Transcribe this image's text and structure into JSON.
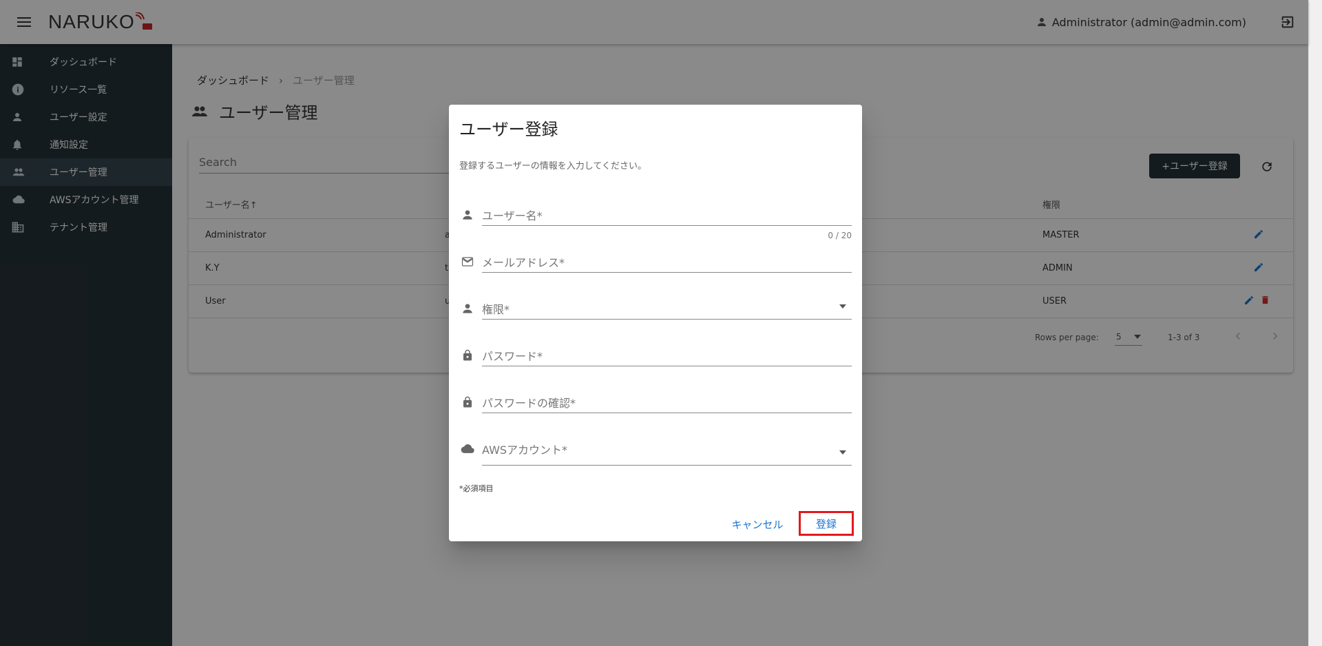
{
  "appbar": {
    "menu_icon": "menu-icon",
    "logo_text": "NARUKO",
    "user_label": "Administrator (admin@admin.com)",
    "user_icon": "person-icon",
    "logout_icon": "logout-icon"
  },
  "sidebar": {
    "items": [
      {
        "label": "ダッシュボード",
        "icon": "dashboard-icon",
        "active": false
      },
      {
        "label": "リソース一覧",
        "icon": "info-icon",
        "active": false
      },
      {
        "label": "ユーザー設定",
        "icon": "person-icon",
        "active": false
      },
      {
        "label": "通知設定",
        "icon": "bell-icon",
        "active": false
      },
      {
        "label": "ユーザー管理",
        "icon": "people-icon",
        "active": true
      },
      {
        "label": "AWSアカウント管理",
        "icon": "cloud-icon",
        "active": false
      },
      {
        "label": "テナント管理",
        "icon": "building-icon",
        "active": false
      }
    ]
  },
  "breadcrumb": {
    "root": "ダッシュボード",
    "separator": "›",
    "current": "ユーザー管理"
  },
  "page": {
    "title": "ユーザー管理",
    "search_placeholder": "Search",
    "add_button": "+ユーザー登録"
  },
  "table": {
    "headers": {
      "username": "ユーザー名",
      "sort_arrow": "↑",
      "role": "権限"
    },
    "rows": [
      {
        "username": "Administrator",
        "email_fragment": "a",
        "role": "MASTER",
        "deletable": false
      },
      {
        "username": "K.Y",
        "email_fragment": "t",
        "role": "ADMIN",
        "deletable": false
      },
      {
        "username": "User",
        "email_fragment": "u",
        "role": "USER",
        "deletable": true
      }
    ],
    "footer": {
      "rows_per_page_label": "Rows per page:",
      "rows_per_page_value": "5",
      "range": "1-3 of 3"
    }
  },
  "dialog": {
    "title": "ユーザー登録",
    "description": "登録するユーザーの情報を入力してください。",
    "fields": {
      "username": "ユーザー名*",
      "username_counter": "0 / 20",
      "email": "メールアドレス*",
      "role": "権限*",
      "password": "パスワード*",
      "password_confirm": "パスワードの確認*",
      "aws_account": "AWSアカウント*"
    },
    "required_note": "*必須項目",
    "cancel": "キャンセル",
    "submit": "登録"
  },
  "colors": {
    "sidebar_bg": "#263238",
    "sidebar_active": "#37474f",
    "primary_button": "#263238",
    "accent_blue": "#1976d2",
    "delete_red": "#d32f2f",
    "highlight_red": "#e3191d"
  }
}
